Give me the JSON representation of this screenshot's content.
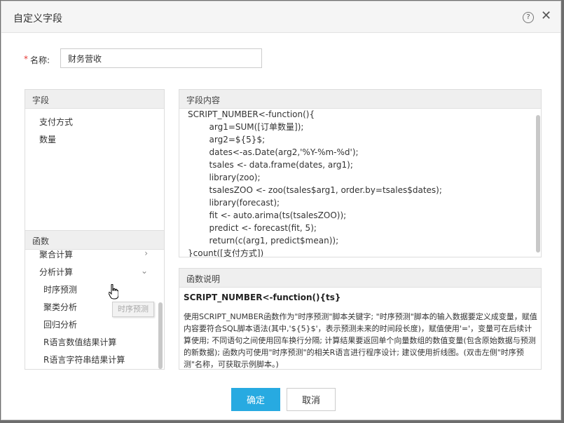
{
  "dialog": {
    "title": "自定义字段",
    "help_glyph": "?",
    "close_glyph": "✕"
  },
  "name_field": {
    "required_mark": "*",
    "label": "名称:",
    "value": "财务营收"
  },
  "fields_panel": {
    "header": "字段",
    "items": [
      "支付方式",
      "数量"
    ]
  },
  "functions_panel": {
    "header": "函数",
    "groups": [
      {
        "label": "聚合计算",
        "chevron": "›"
      },
      {
        "label": "分析计算",
        "chevron": "⌄"
      }
    ],
    "sub_items": [
      "时序预测",
      "聚类分析",
      "回归分析",
      "R语言数值结果计算",
      "R语言字符串结果计算"
    ],
    "tooltip": "时序预测"
  },
  "content_panel": {
    "header": "字段内容",
    "code": "SCRIPT_NUMBER<-function(){\n        arg1=SUM([订单数量]);\n        arg2=${5}$;\n        dates<-as.Date(arg2,'%Y-%m-%d');\n        tsales <- data.frame(dates, arg1);\n        library(zoo);\n        tsalesZOO <- zoo(tsales$arg1, order.by=tsales$dates);\n        library(forecast);\n        fit <- auto.arima(ts(tsalesZOO));\n        predict <- forecast(fit, 5);\n        return(c(arg1, predict$mean));\n}count([支付方式])"
  },
  "description_panel": {
    "header": "函数说明",
    "signature": "SCRIPT_NUMBER<-function(){ts}",
    "text": "使用SCRIPT_NUMBER函数作为\"时序预测\"脚本关键字; \"时序预测\"脚本的输入数据要定义成变量，赋值内容要符合SQL脚本语法(其中,'${5}$'，表示预测未来的时间段长度)，赋值使用'='，变量可在后续计算使用; 不同语句之间使用回车换行分隔; 计算结果要返回单个向量数组的数值变量(包含原始数据与预测的新数据); 函数内可使用\"时序预测\"的相关R语言进行程序设计; 建议使用折线图。(双击左侧\"时序预测\"名称，可获取示例脚本。)"
  },
  "buttons": {
    "ok": "确定",
    "cancel": "取消"
  },
  "colors": {
    "primary": "#27aae1",
    "required": "#e53935",
    "header_bg": "#efefef"
  }
}
